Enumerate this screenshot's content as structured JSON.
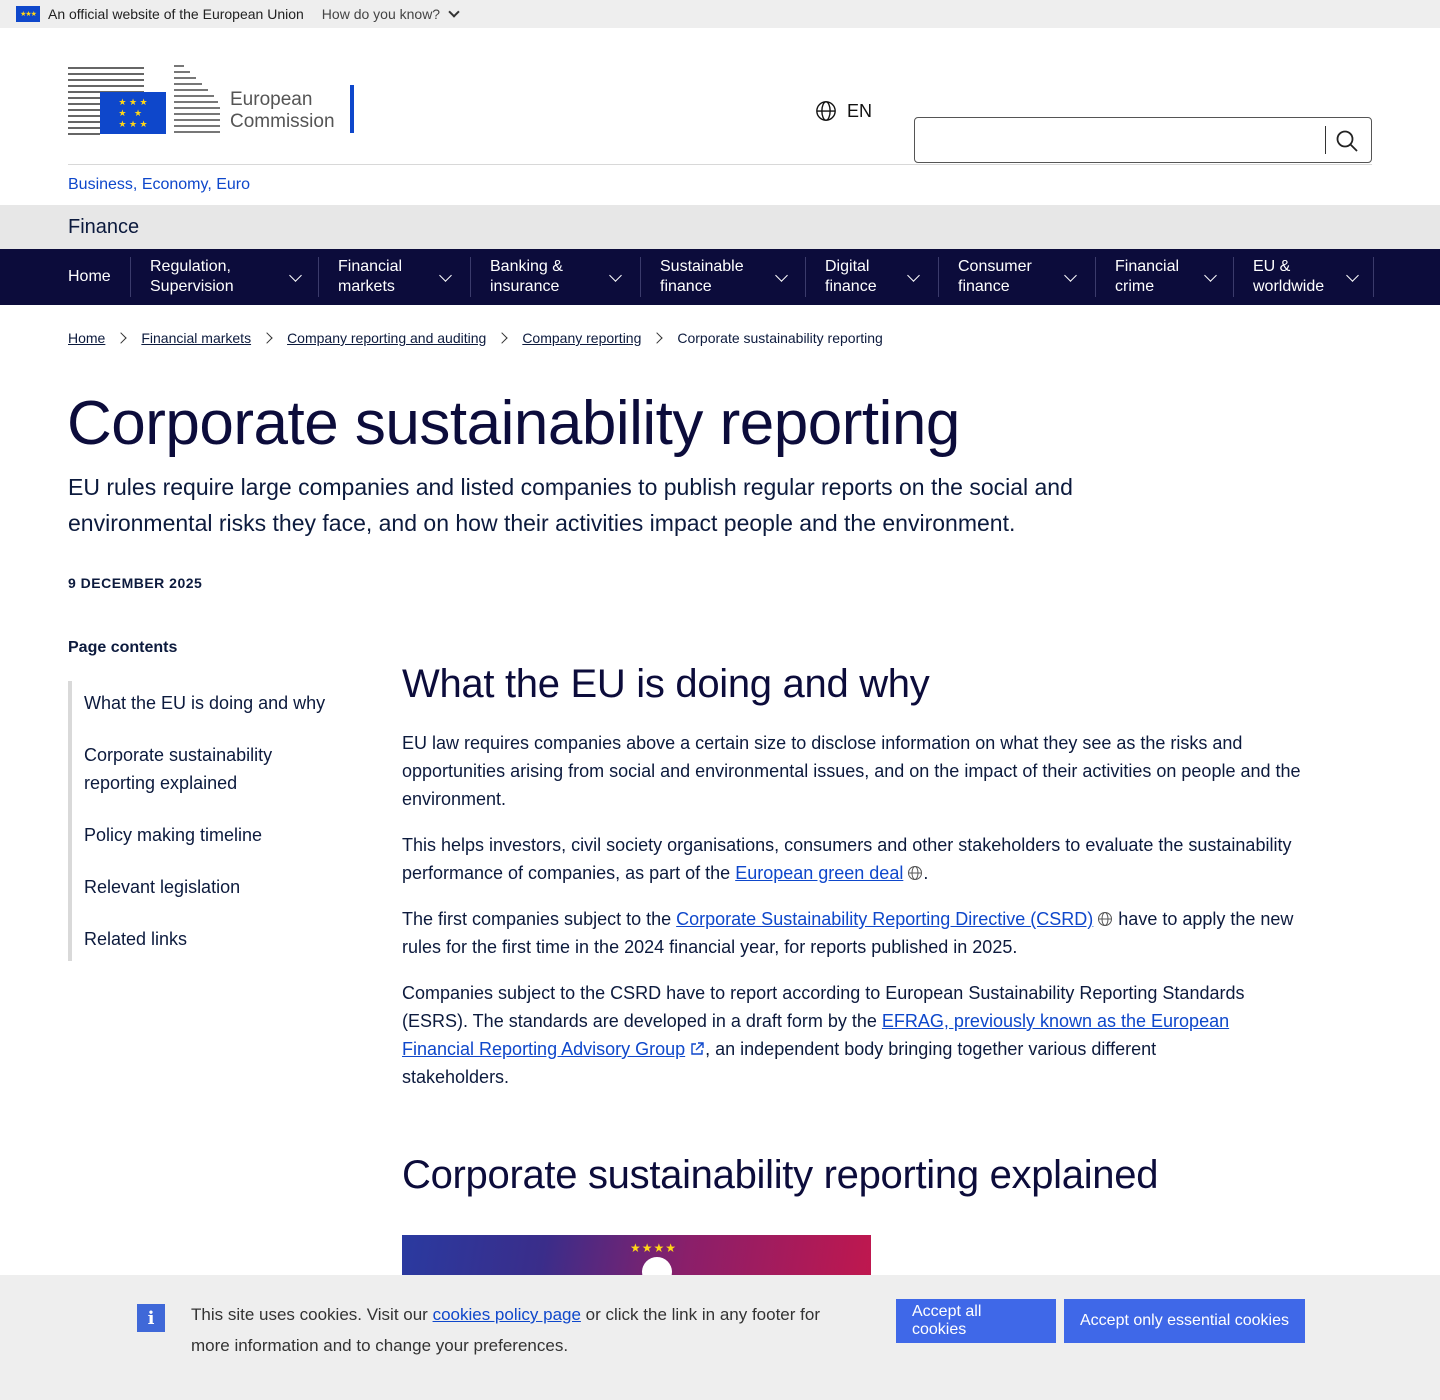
{
  "official_banner": {
    "text": "An official website of the European Union",
    "how_label": "How do you know?"
  },
  "header": {
    "logo_line1": "European",
    "logo_line2": "Commission",
    "lang_code": "EN",
    "search_placeholder": ""
  },
  "site": {
    "name": "Business, Economy, Euro",
    "sub": "Finance"
  },
  "nav": [
    {
      "label": "Home"
    },
    {
      "label": "Regulation, Supervision"
    },
    {
      "label": "Financial markets"
    },
    {
      "label": "Banking & insurance"
    },
    {
      "label": "Sustainable finance"
    },
    {
      "label": "Digital finance"
    },
    {
      "label": "Consumer finance"
    },
    {
      "label": "Financial crime"
    },
    {
      "label": "EU & worldwide"
    }
  ],
  "breadcrumb": [
    "Home",
    "Financial markets",
    "Company reporting and auditing",
    "Company reporting",
    "Corporate sustainability reporting"
  ],
  "page": {
    "title": "Corporate sustainability reporting",
    "lead": "EU rules require large companies and listed companies to publish regular reports on the social and environmental risks they face, and on how their activities impact people and  the environment.",
    "date": "9 DECEMBER 2025"
  },
  "toc": {
    "title": "Page contents",
    "items": [
      "What the EU is doing and why",
      "Corporate sustainability reporting explained",
      "Policy making timeline",
      "Relevant legislation",
      "Related links"
    ]
  },
  "content": {
    "h2_1": "What the EU is doing and why",
    "p1": "EU law requires companies above a certain size to disclose information on what they see as the risks and opportunities arising from social and environmental issues, and on the impact of their activities on people and the environment.",
    "p2_pre": "This helps investors, civil society organisations, consumers and other stakeholders to evaluate the sustainability performance of companies, as part of the ",
    "p2_link": "European green deal",
    "p2_post": ".",
    "p3_pre": "The first companies subject to the ",
    "p3_link": "Corporate Sustainability Reporting Directive (CSRD)",
    "p3_post": " have to apply the new rules for the first time in the 2024 financial year, for reports published in 2025.",
    "p4_pre": "Companies subject to the CSRD have to report according to European Sustainability Reporting Standards (ESRS). The standards are developed in a draft form by the ",
    "p4_link": "EFRAG, previously known as the European Financial Reporting Advisory Group",
    "p4_post": ", an independent body bringing together various different stakeholders.",
    "h2_2": "Corporate sustainability reporting explained"
  },
  "cookie": {
    "text_pre": "This site uses cookies. Visit our ",
    "link": "cookies policy page",
    "text_post": " or click the link in any footer for more information and to change your preferences.",
    "accept_all": "Accept all cookies",
    "accept_essential": "Accept only essential cookies"
  },
  "colors": {
    "nav_bg": "#0c0c3b",
    "link": "#0e47cb",
    "button": "#3f68e8"
  }
}
